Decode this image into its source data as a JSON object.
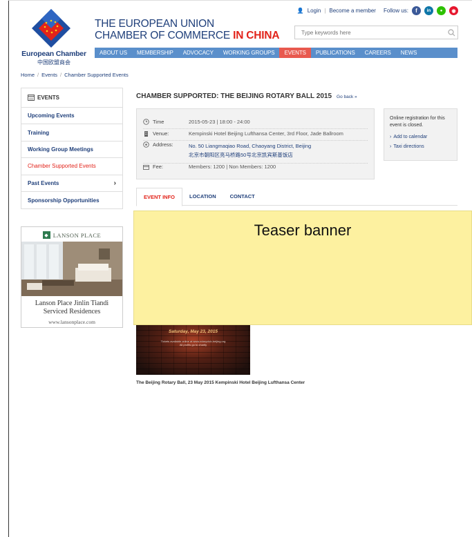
{
  "header": {
    "title_line1": "THE EUROPEAN UNION",
    "title_line2_prefix": "CHAMBER OF COMMERCE ",
    "title_line2_red": "IN CHINA",
    "brand_en": "European Chamber",
    "brand_zh": "中国欧盟商会",
    "login": "Login",
    "become_member": "Become a member",
    "follow_us": "Follow us:",
    "social": [
      {
        "name": "facebook-icon",
        "glyph": "f",
        "color": "#3b5998"
      },
      {
        "name": "linkedin-icon",
        "glyph": "in",
        "color": "#0e76a8"
      },
      {
        "name": "wechat-icon",
        "glyph": "●",
        "color": "#2dc100"
      },
      {
        "name": "weibo-icon",
        "glyph": "◉",
        "color": "#e6162d"
      }
    ],
    "search_placeholder": "Type keywords here"
  },
  "nav": {
    "items": [
      "ABOUT US",
      "MEMBERSHIP",
      "ADVOCACY",
      "WORKING GROUPS",
      "EVENTS",
      "PUBLICATIONS",
      "CAREERS",
      "NEWS"
    ],
    "active": "EVENTS"
  },
  "breadcrumb": [
    "Home",
    "Events",
    "Chamber Supported Events"
  ],
  "sidebar": {
    "heading": "EVENTS",
    "items": [
      {
        "label": "Upcoming Events",
        "arrow": ""
      },
      {
        "label": "Training",
        "arrow": ""
      },
      {
        "label": "Working Group Meetings",
        "arrow": ""
      },
      {
        "label": "Chamber Supported Events",
        "arrow": ""
      },
      {
        "label": "Past Events",
        "arrow": "›"
      },
      {
        "label": "Sponsorship Opportunities",
        "arrow": ""
      }
    ],
    "active_index": 3
  },
  "ad": {
    "brand": "LANSON PLACE",
    "caption_line1": "Lanson Place Jinlin Tiandi",
    "caption_line2": "Serviced Residences",
    "url": "www.lansonplace.com"
  },
  "event": {
    "title": "CHAMBER SUPPORTED: THE BEIJING ROTARY BALL 2015",
    "go_back": "Go back »",
    "time_label": "Time",
    "time_value": "2015-05-23 | 18:00 - 24:00",
    "venue_label": "Venue:",
    "venue_value": "Kempinski Hotel Beijing Lufthansa Center, 3rd Floor, Jade Ballroom",
    "address_label": "Address:",
    "address_value_en": "No. 50 Liangmaqiao Road, Chaoyang District, Beijing",
    "address_value_zh": "北京市朝阳区亮马桥路50号北京凯宾斯基饭店",
    "fee_label": "Fee:",
    "fee_value": "Members: 1200 | Non Members: 1200"
  },
  "registration": {
    "closed_text": "Online registration for this event is closed.",
    "add_calendar": "Add to calendar",
    "taxi": "Taxi directions"
  },
  "tabs": {
    "items": [
      "EVENT INFO",
      "LOCATION",
      "CONTACT"
    ],
    "active": "EVENT INFO"
  },
  "teaser": {
    "label": "Teaser banner"
  },
  "poster": {
    "line1": "Saturday, May 23, 2015",
    "line2": "Tickets available online at www.rotaryclub-beijing.org",
    "line3": "All profits go to charity"
  },
  "caption": "The Beijing Rotary Ball, 23 May 2015 Kempinski Hotel Beijing Lufthansa Center"
}
